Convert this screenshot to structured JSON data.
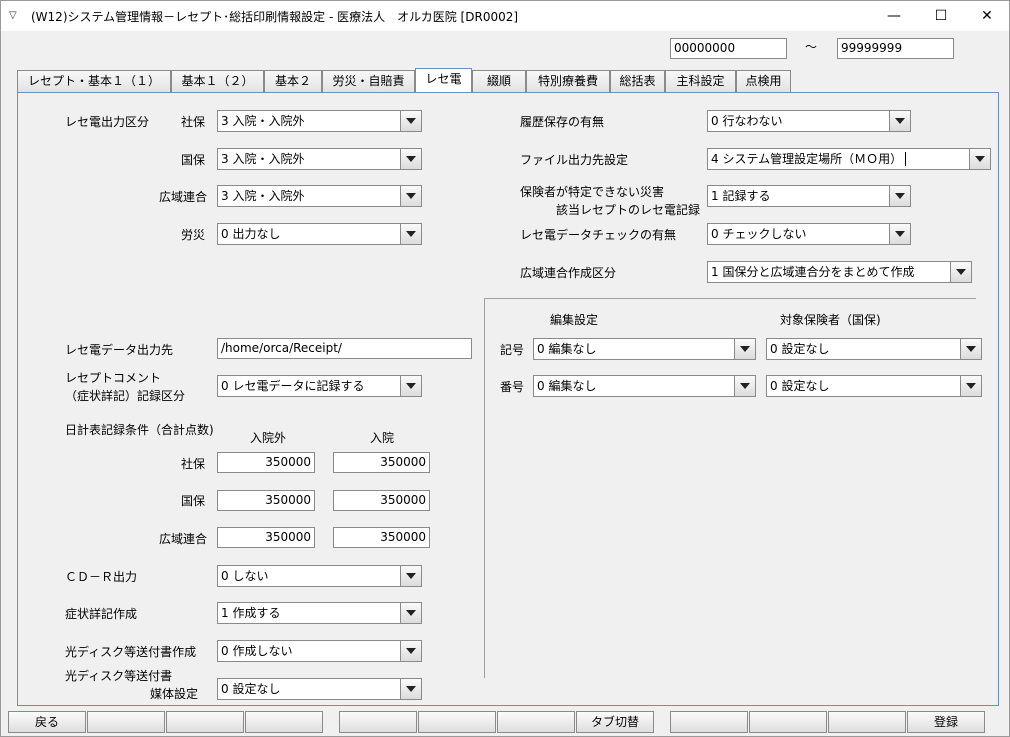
{
  "window": {
    "title": "(W12)システム管理情報－レセプト･総括印刷情報設定 - 医療法人　オルカ医院 [DR0002]",
    "minimize": "—",
    "maximize": "☐",
    "close": "✕"
  },
  "range": {
    "from": "00000000",
    "tilde": "～",
    "to": "99999999"
  },
  "tabs": [
    "レセプト・基本１（１）",
    "基本１（２）",
    "基本２",
    "労災・自賠責",
    "レセ電",
    "綴順",
    "特別療養費",
    "総括表",
    "主科設定",
    "点検用"
  ],
  "active_tab": "レセ電",
  "left": {
    "rece_output_label": "レセ電出力区分",
    "shaho_label": "社保",
    "shaho_value": "3 入院・入院外",
    "kokuho_label": "国保",
    "kokuho_value": "3 入院・入院外",
    "koiki_label": "広域連合",
    "koiki_value": "3 入院・入院外",
    "rosai_label": "労災",
    "rosai_value": "0 出力なし",
    "data_dest_label": "レセ電データ出力先",
    "data_dest_value": "/home/orca/Receipt/",
    "comment_label_1": "レセプトコメント",
    "comment_label_2": "（症状詳記）記録区分",
    "comment_value": "0 レセ電データに記録する",
    "daily_label": "日計表記録条件（合計点数)",
    "outpatient_header": "入院外",
    "inpatient_header": "入院",
    "daily_shaho_label": "社保",
    "daily_shaho_out": "350000",
    "daily_shaho_in": "350000",
    "daily_kokuho_label": "国保",
    "daily_kokuho_out": "350000",
    "daily_kokuho_in": "350000",
    "daily_koiki_label": "広域連合",
    "daily_koiki_out": "350000",
    "daily_koiki_in": "350000",
    "cdr_label": "ＣＤ－Ｒ出力",
    "cdr_value": "0 しない",
    "shojo_label": "症状詳記作成",
    "shojo_value": "1 作成する",
    "hikari_label": "光ディスク等送付書作成",
    "hikari_value": "0 作成しない",
    "baitai_label_1": "光ディスク等送付書",
    "baitai_label_2": "媒体設定",
    "baitai_value": "0 設定なし"
  },
  "right": {
    "history_label": "履歴保存の有無",
    "history_value": "0 行なわない",
    "file_dest_label": "ファイル出力先設定",
    "file_dest_value": "4 システム管理設定場所（ＭＯ用）",
    "disaster_label_1": "保険者が特定できない災害",
    "disaster_label_2": "該当レセプトのレセ電記録",
    "disaster_value": "1 記録する",
    "check_label": "レセ電データチェックの有無",
    "check_value": "0 チェックしない",
    "koiki_create_label": "広域連合作成区分",
    "koiki_create_value": "1 国保分と広域連合分をまとめて作成",
    "edit_header": "編集設定",
    "target_header": "対象保険者（国保)",
    "kigo_label": "記号",
    "kigo_edit": "0 編集なし",
    "kigo_target": "0 設定なし",
    "bango_label": "番号",
    "bango_edit": "0 編集なし",
    "bango_target": "0 設定なし"
  },
  "footer": {
    "back": "戻る",
    "tab_switch": "タブ切替",
    "register": "登録"
  }
}
